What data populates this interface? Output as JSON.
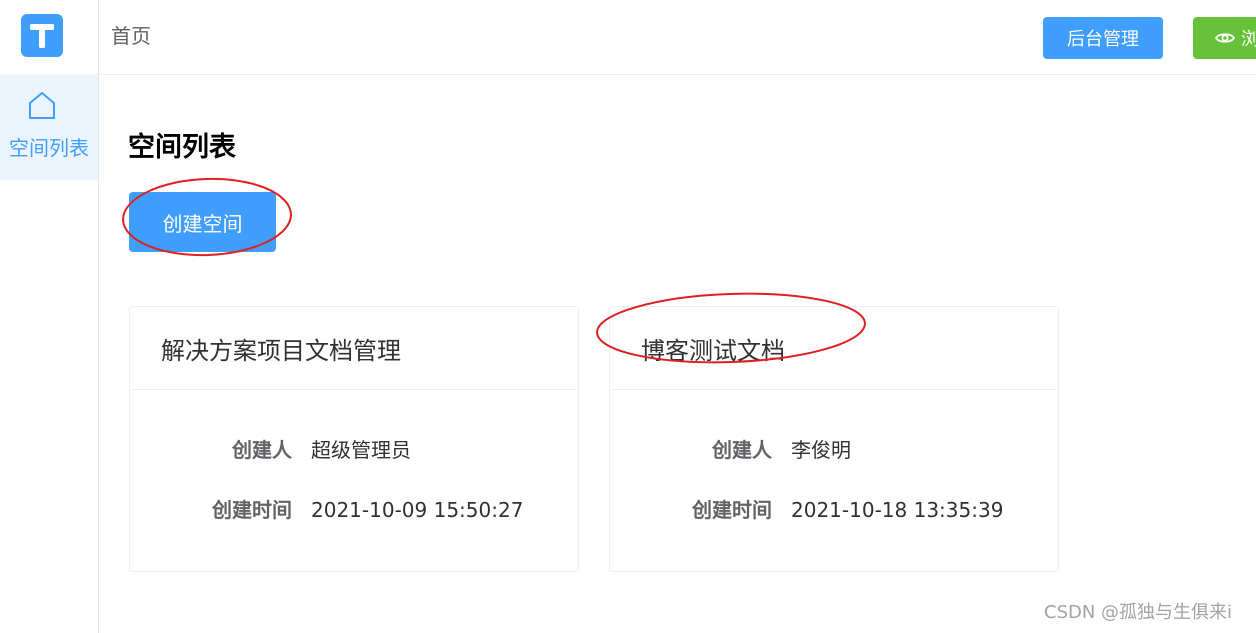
{
  "header": {
    "breadcrumb": "首页",
    "admin_button": "后台管理",
    "browse_button": "浏"
  },
  "sidebar": {
    "logo_letter": "T",
    "items": [
      {
        "label": "空间列表",
        "icon": "home-icon"
      }
    ]
  },
  "main": {
    "title": "空间列表",
    "create_button": "创建空间",
    "spaces": [
      {
        "name": "解决方案项目文档管理",
        "creator_label": "创建人",
        "creator": "超级管理员",
        "time_label": "创建时间",
        "time": "2021-10-09 15:50:27"
      },
      {
        "name": "博客测试文档",
        "creator_label": "创建人",
        "creator": "李俊明",
        "time_label": "创建时间",
        "time": "2021-10-18 13:35:39"
      }
    ]
  },
  "watermark": "CSDN @孤独与生俱来i",
  "colors": {
    "primary": "#409eff",
    "success": "#67c23a",
    "annotation": "#e02020",
    "active_bg": "#ecf5ff"
  }
}
